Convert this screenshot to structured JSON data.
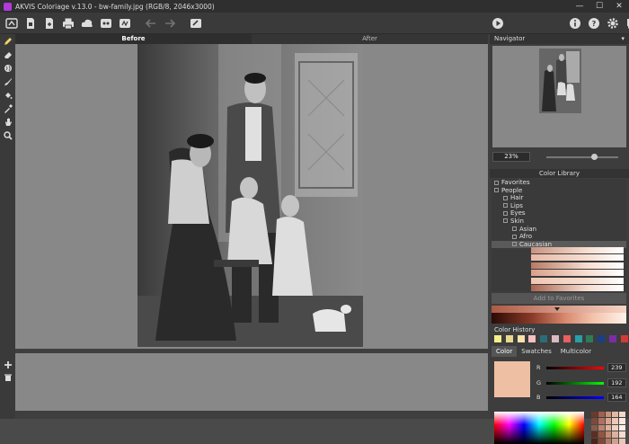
{
  "window": {
    "title": "AKVIS Coloriage v.13.0 - bw-family.jpg (RGB/8, 2046x3000)",
    "minimize": "—",
    "maximize": "☐",
    "close": "✕"
  },
  "canvas": {
    "tab_before": "Before",
    "tab_after": "After"
  },
  "navigator": {
    "title": "Navigator",
    "zoom": "23%"
  },
  "color_library": {
    "title": "Color Library",
    "items": [
      {
        "label": "Favorites",
        "indent": 0
      },
      {
        "label": "People",
        "indent": 0
      },
      {
        "label": "Hair",
        "indent": 1
      },
      {
        "label": "Lips",
        "indent": 1
      },
      {
        "label": "Eyes",
        "indent": 1
      },
      {
        "label": "Skin",
        "indent": 1
      },
      {
        "label": "Asian",
        "indent": 2
      },
      {
        "label": "Afro",
        "indent": 2
      },
      {
        "label": "Caucasian",
        "indent": 2
      }
    ],
    "swatch_colors": [
      "#c9937f",
      "#e7b9a6",
      "#b97a63",
      "#d9a08a",
      "#f0c6b4",
      "#a9644e",
      "#e9b19c",
      "#c48570"
    ],
    "add_favorites": "Add to Favorites"
  },
  "color_history": {
    "title": "Color History",
    "colors": [
      "#f6f08a",
      "#e8d98f",
      "#fbe0a8",
      "#f5c0c0",
      "#2a6d7a",
      "#d9b9c4",
      "#e86060",
      "#27a0a6",
      "#2f7a57",
      "#1a3f86",
      "#7a2da6",
      "#d23a3a",
      "#3ad24a"
    ]
  },
  "color_tabs": [
    "Color",
    "Swatches",
    "Multicolor"
  ],
  "color": {
    "current": "#efbfa4",
    "r_label": "R",
    "r_value": "239",
    "g_label": "G",
    "g_value": "192",
    "b_label": "B",
    "b_value": "164"
  },
  "icons": {
    "toolbar": [
      "open-icon",
      "new-icon",
      "save-icon",
      "print-icon",
      "share-icon",
      "ai-icon",
      "batch-icon",
      "undo-icon",
      "redo-icon",
      "reset-icon"
    ],
    "toolbar_right": [
      "play-icon",
      "info-icon",
      "help-icon",
      "settings-icon",
      "feedback-icon"
    ],
    "left": [
      "pencil-icon",
      "eraser-icon",
      "globe-icon",
      "brush-icon",
      "bucket-icon",
      "eyedropper-icon",
      "hand-icon",
      "zoom-icon"
    ]
  }
}
